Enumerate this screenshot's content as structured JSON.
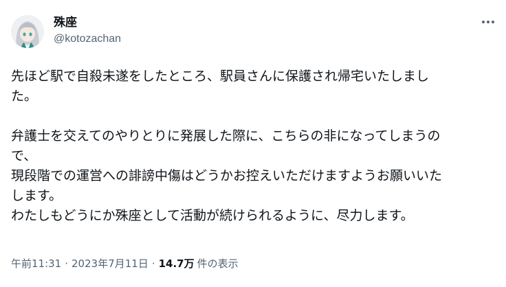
{
  "author": {
    "display_name": "殊座",
    "handle": "@kotozachan"
  },
  "more_icon": "more-horizontal-icon",
  "body_lines": [
    "先ほど駅で自殺未遂をしたところ、駅員さんに保護され帰宅いたしまし",
    "た。",
    "",
    "弁護士を交えてのやりとりに発展した際に、こちらの非になってしまうの",
    "で、",
    "現段階での運営への誹謗中傷はどうかお控えいただけますようお願いいた",
    "します。",
    "わたしもどうにか殊座として活動が続けられるように、尽力します。"
  ],
  "meta": {
    "time": "午前11:31",
    "separator": "·",
    "date": "2023年7月11日",
    "views_count": "14.7万",
    "views_label": "件の表示"
  }
}
